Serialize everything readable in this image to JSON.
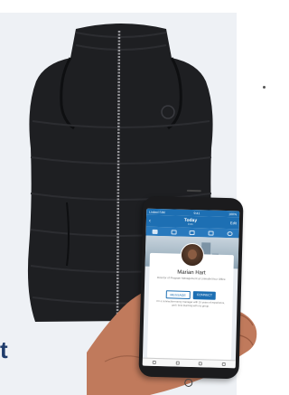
{
  "brand": {
    "partial_word": "t"
  },
  "phone": {
    "status": {
      "carrier": "Linked SIM",
      "time": "9:41",
      "battery": "100%"
    },
    "nav": {
      "back": "‹",
      "title": "Today",
      "subtitle": "9:41",
      "edit": "Edit"
    },
    "tabs": [
      "home-icon",
      "people-icon",
      "briefcase-icon",
      "bell-icon",
      "profile-icon"
    ],
    "profile": {
      "name": "Marian Hart",
      "title": "Director of Program Management at LinkedIn/Your Office",
      "message_label": "MESSAGE",
      "connect_label": "CONNECT",
      "description": "I'm a connection-savvy manager with 15 years of experience, and I love learning with my group."
    },
    "bottom_icons": [
      "feed-icon",
      "search-icon",
      "network-icon",
      "messages-icon"
    ]
  },
  "colors": {
    "accent": "#1d6fb3",
    "brand_text": "#1f3c6b",
    "vest": "#1e1f22"
  }
}
